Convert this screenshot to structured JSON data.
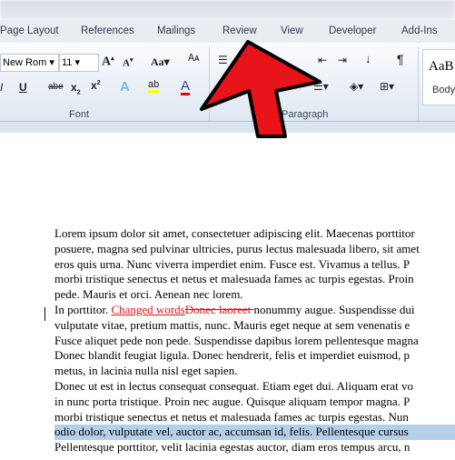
{
  "tabs": [
    "Page Layout",
    "References",
    "Mailings",
    "Review",
    "View",
    "Developer",
    "Add-Ins"
  ],
  "font": {
    "name": "New Rom",
    "size": "11",
    "group_label": "Font"
  },
  "paragraph": {
    "group_label": "Paragraph"
  },
  "styles": {
    "preview": "AaB",
    "label": "Body"
  },
  "document": {
    "lines": [
      "Lorem ipsum dolor sit amet, consectetuer adipiscing elit. Maecenas porttitor",
      "posuere, magna sed pulvinar ultricies, purus lectus malesuada libero, sit amet",
      "eros quis urna. Nunc viverra imperdiet enim. Fusce est. Vivamus a tellus. P",
      "morbi tristique senectus et netus et malesuada fames ac turpis egestas. Proin",
      "pede. Mauris et orci. Aenean nec lorem."
    ],
    "tracked_prefix": "In porttitor. ",
    "inserted": "Changed words",
    "deleted": "Donec laoreet ",
    "tracked_suffix": "nonummy augue. Suspendisse dui",
    "lines2": [
      "vulputate vitae, pretium mattis, nunc. Mauris eget neque at sem venenatis e",
      "Fusce aliquet pede non pede. Suspendisse dapibus lorem pellentesque magna",
      "Donec blandit feugiat ligula. Donec hendrerit, felis et imperdiet euismod, p",
      "metus, in lacinia nulla nisl eget sapien.",
      "Donec ut est in lectus consequat consequat. Etiam eget dui. Aliquam erat vo",
      "in nunc porta tristique. Proin nec augue. Quisque aliquam tempor magna. P",
      "morbi tristique senectus et netus et malesuada fames ac turpis egestas. Nun"
    ],
    "selected": "odio dolor, vulputate vel, auctor ac, accumsan id, felis. Pellentesque cursus",
    "last": "Pellentesque porttitor, velit lacinia egestas auctor, diam eros tempus arcu, n"
  },
  "colors": {
    "arrow": "#e8141a",
    "track_change": "#dd1111",
    "selection": "#b5cfe9"
  }
}
